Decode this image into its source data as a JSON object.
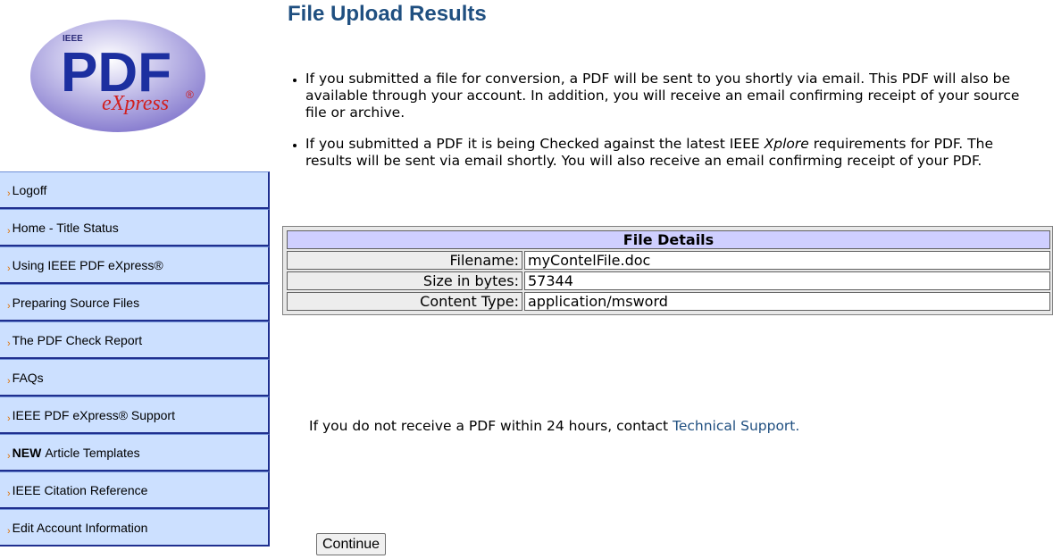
{
  "logo": {
    "ieee_text": "IEEE",
    "pdf_text": "PDF",
    "express_text": "eXpress",
    "reg_mark": "®"
  },
  "sidebar": {
    "items": [
      {
        "label": "Logoff"
      },
      {
        "label": "Home - Title Status"
      },
      {
        "label": "Using IEEE PDF eXpress®"
      },
      {
        "label": "Preparing Source Files"
      },
      {
        "label": "The PDF Check Report"
      },
      {
        "label": "FAQs"
      },
      {
        "label": "IEEE PDF eXpress® Support"
      },
      {
        "prefix": "NEW",
        "label": "Article Templates"
      },
      {
        "label": "IEEE Citation Reference"
      },
      {
        "label": "Edit Account Information"
      }
    ]
  },
  "main": {
    "title": "File Upload Results",
    "bullet1": "If you submitted a file for conversion, a PDF will be sent to you shortly via email. This PDF will also be available through your account. In addition, you will receive an email confirming receipt of your source file or archive.",
    "bullet2_before": "If you submitted a PDF it is being Checked against the latest IEEE ",
    "bullet2_italic": "Xplore",
    "bullet2_after": " requirements for PDF. The results will be sent via email shortly. You will also receive an email confirming receipt of your PDF.",
    "details": {
      "header": "File Details",
      "rows": [
        {
          "label": "Filename:",
          "value": "myContelFile.doc"
        },
        {
          "label": "Size in bytes:",
          "value": "57344"
        },
        {
          "label": "Content Type:",
          "value": "application/msword"
        }
      ]
    },
    "support_text": "If you do not receive a PDF within 24 hours, contact ",
    "support_link": "Technical Support.",
    "continue_label": "Continue"
  },
  "colors": {
    "title": "#1f4f80",
    "nav_bg": "#cce0ff",
    "nav_border": "#1f2f8f",
    "arrow": "#e07000",
    "table_header": "#cfcfff"
  }
}
